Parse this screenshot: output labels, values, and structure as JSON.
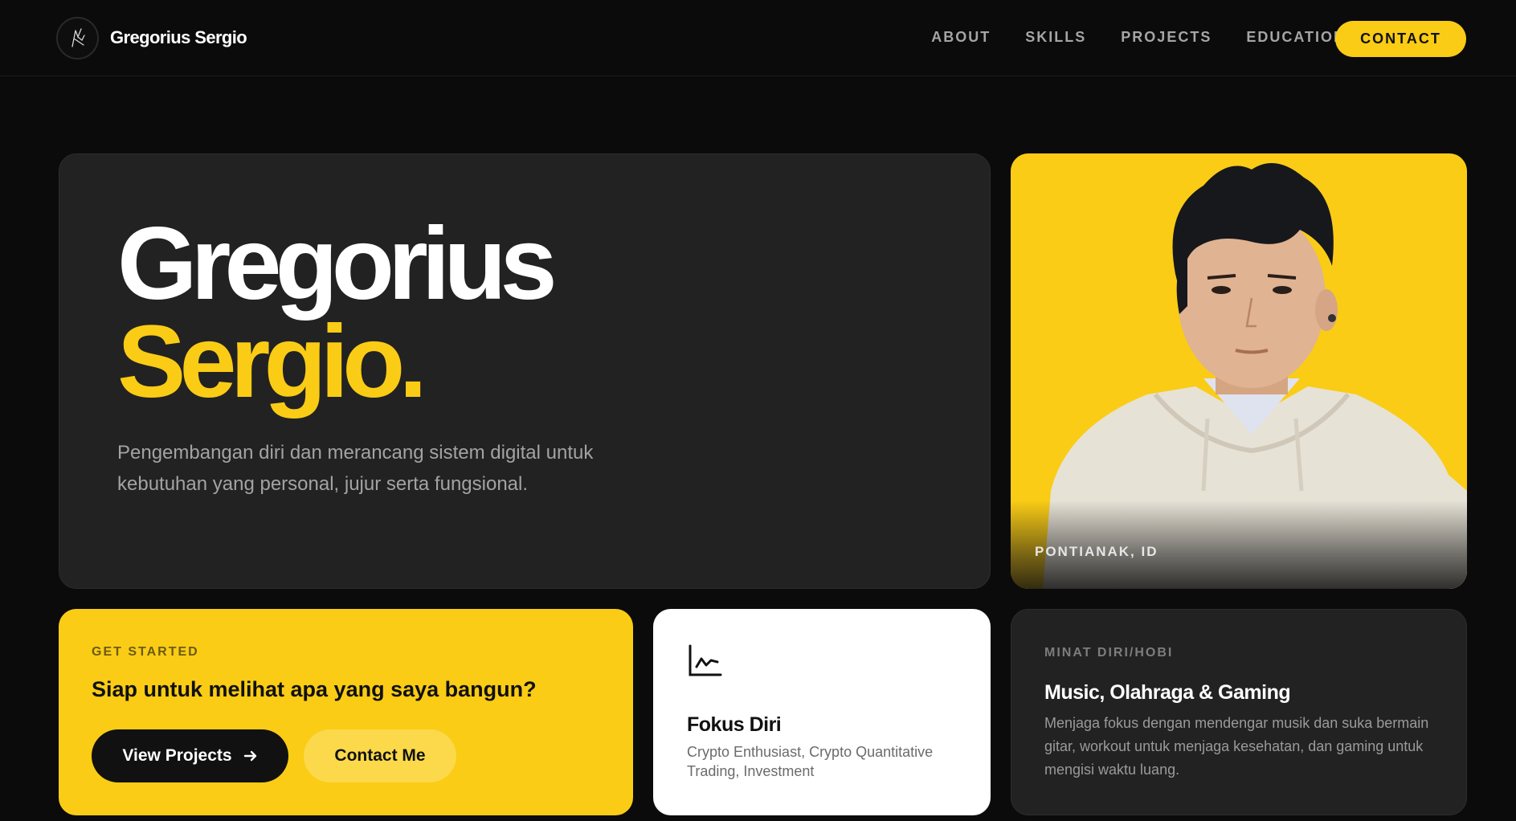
{
  "nav": {
    "brand_name": "Gregorius Sergio",
    "links": [
      "ABOUT",
      "SKILLS",
      "PROJECTS",
      "EDUCATION"
    ],
    "contact_label": "CONTACT"
  },
  "hero": {
    "title_line1": "Gregorius",
    "title_line2": "Sergio.",
    "description": "Pengembangan diri dan merancang sistem digital untuk kebutuhan yang personal, jujur serta fungsional."
  },
  "photo": {
    "location": "PONTIANAK, ID"
  },
  "cta": {
    "eyebrow": "GET STARTED",
    "question": "Siap untuk melihat apa yang saya bangun?",
    "primary_label": "View Projects",
    "primary_icon": "arrow-right-icon",
    "secondary_label": "Contact Me"
  },
  "focus": {
    "icon": "line-chart-icon",
    "title": "Fokus Diri",
    "description": "Crypto Enthusiast, Crypto Quantitative Trading, Investment"
  },
  "hobby": {
    "eyebrow": "MINAT DIRI/HOBI",
    "title": "Music, Olahraga & Gaming",
    "description": "Menjaga fokus dengan mendengar musik dan suka bermain gitar, workout untuk menjaga kesehatan, dan gaming untuk mengisi waktu luang."
  },
  "colors": {
    "accent": "#facc15",
    "background": "#0b0b0b",
    "card": "#222222"
  }
}
